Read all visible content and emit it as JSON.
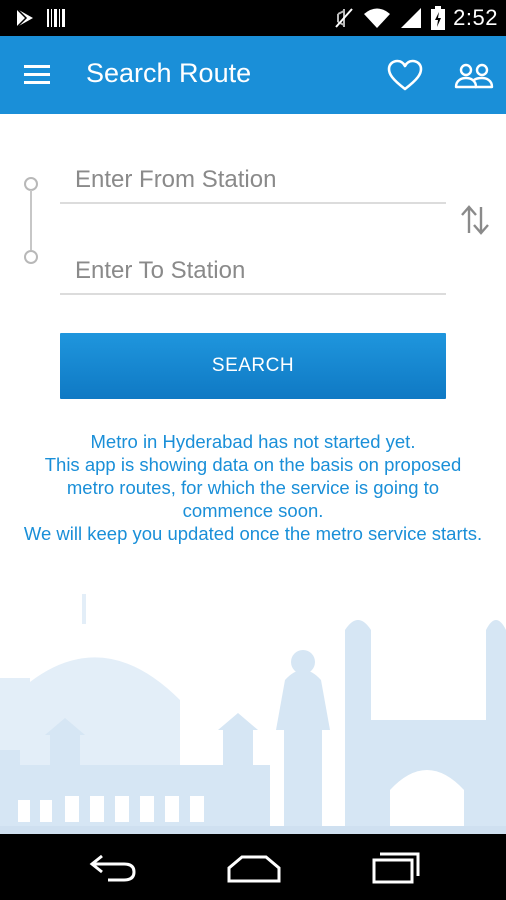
{
  "status_bar": {
    "time": "2:52",
    "icons": [
      "play-store-icon",
      "barcode-icon",
      "mute-icon",
      "wifi-icon",
      "signal-icon",
      "battery-charging-icon"
    ]
  },
  "app_bar": {
    "title": "Search Route",
    "icons": [
      "menu-icon",
      "heart-icon",
      "people-icon"
    ]
  },
  "form": {
    "from_placeholder": "Enter From Station",
    "to_placeholder": "Enter To Station",
    "from_value": "",
    "to_value": "",
    "swap_icon": "swap-vertical-icon",
    "search_label": "SEARCH"
  },
  "notice": {
    "lines": [
      "Metro in Hyderabad has not started yet.",
      "This app is showing data on the basis on proposed metro routes, for which the service is going to commence soon.",
      "We will keep you updated once the metro service starts."
    ]
  },
  "nav_bar": {
    "icons": [
      "back-icon",
      "home-icon",
      "recents-icon"
    ]
  },
  "colors": {
    "primary": "#1a8fd8",
    "skyline": "#dbe9f5"
  }
}
